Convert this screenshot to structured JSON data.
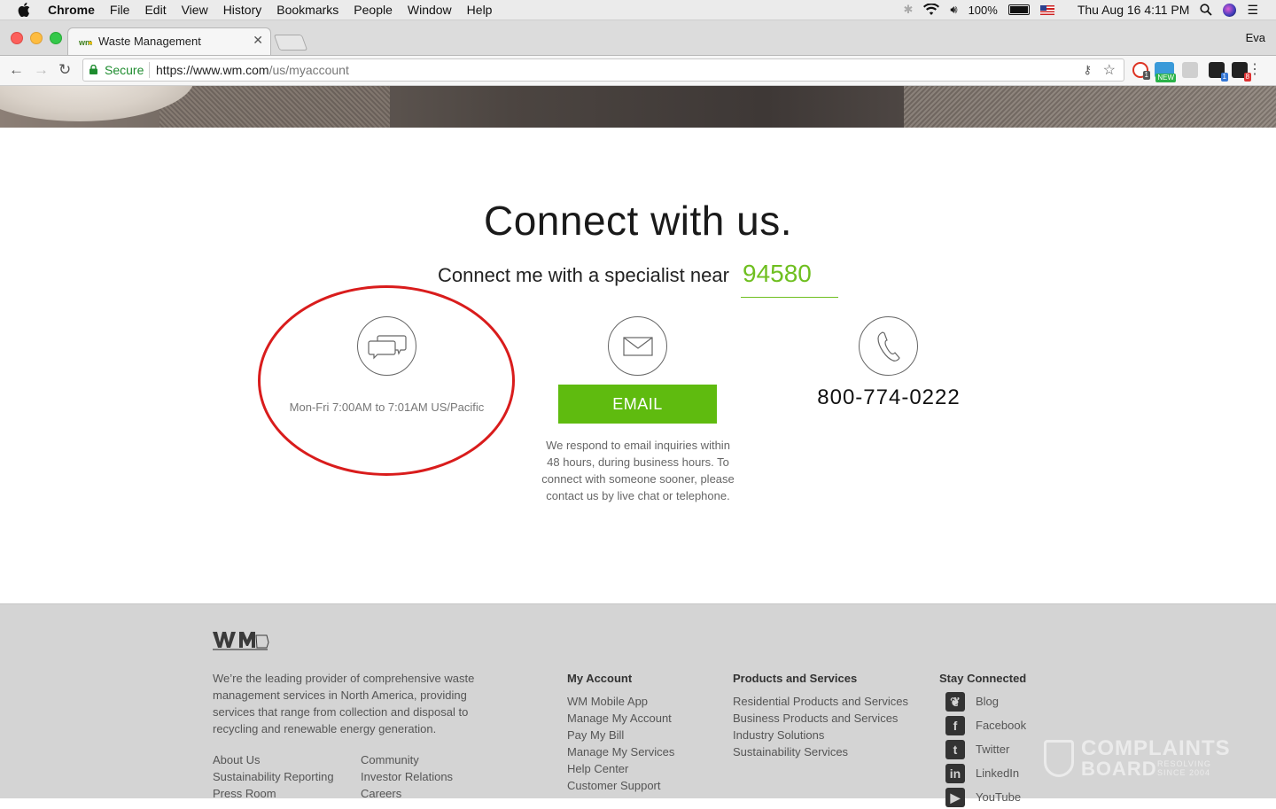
{
  "menubar": {
    "app": "Chrome",
    "items": [
      "File",
      "Edit",
      "View",
      "History",
      "Bookmarks",
      "People",
      "Window",
      "Help"
    ],
    "battery": "100%",
    "datetime": "Thu Aug 16  4:11 PM"
  },
  "browser": {
    "tab_title": "Waste Management",
    "profile": "Eva",
    "secure_label": "Secure",
    "url_host": "https://www.wm.com",
    "url_path": "/us/myaccount",
    "ext_badge_new": "NEW",
    "ext_badge_1": "1",
    "ext_badge_2": "1",
    "ext_badge_3": "8"
  },
  "main": {
    "heading": "Connect with us.",
    "specialist_text": "Connect me with a specialist near",
    "zip": "94580",
    "chat_hours": "Mon-Fri 7:00AM to 7:01AM US/Pacific",
    "email_button": "EMAIL",
    "email_note": "We respond to email inquiries within 48 hours, during business hours. To connect with someone sooner, please contact us by live chat or telephone.",
    "phone": "800-774-0222"
  },
  "footer": {
    "about": "We’re the leading provider of comprehensive waste management services in North America, providing services that range from collection and disposal to recycling and renewable energy generation.",
    "links_col1": [
      "About Us",
      "Sustainability Reporting",
      "Press Room"
    ],
    "links_col2": [
      "Community",
      "Investor Relations",
      "Careers"
    ],
    "my_account": {
      "title": "My Account",
      "items": [
        "WM Mobile App",
        "Manage My Account",
        "Pay My Bill",
        "Manage My Services",
        "Help Center",
        "Customer Support"
      ]
    },
    "products": {
      "title": "Products and Services",
      "items": [
        "Residential Products and Services",
        "Business Products and Services",
        "Industry Solutions",
        "Sustainability Services"
      ]
    },
    "stay_connected": {
      "title": "Stay Connected",
      "items": [
        "Blog",
        "Facebook",
        "Twitter",
        "LinkedIn",
        "YouTube"
      ]
    }
  },
  "watermark": {
    "line1": "COMPLAINTS",
    "line2": "BOARD",
    "tagline1": "RESOLVING",
    "tagline2": "SINCE 2004"
  },
  "colors": {
    "brand_green": "#5fbb0f",
    "zip_green": "#6fbf20",
    "annotation_red": "#d91c1c",
    "footer_bg": "#d4d4d4"
  }
}
